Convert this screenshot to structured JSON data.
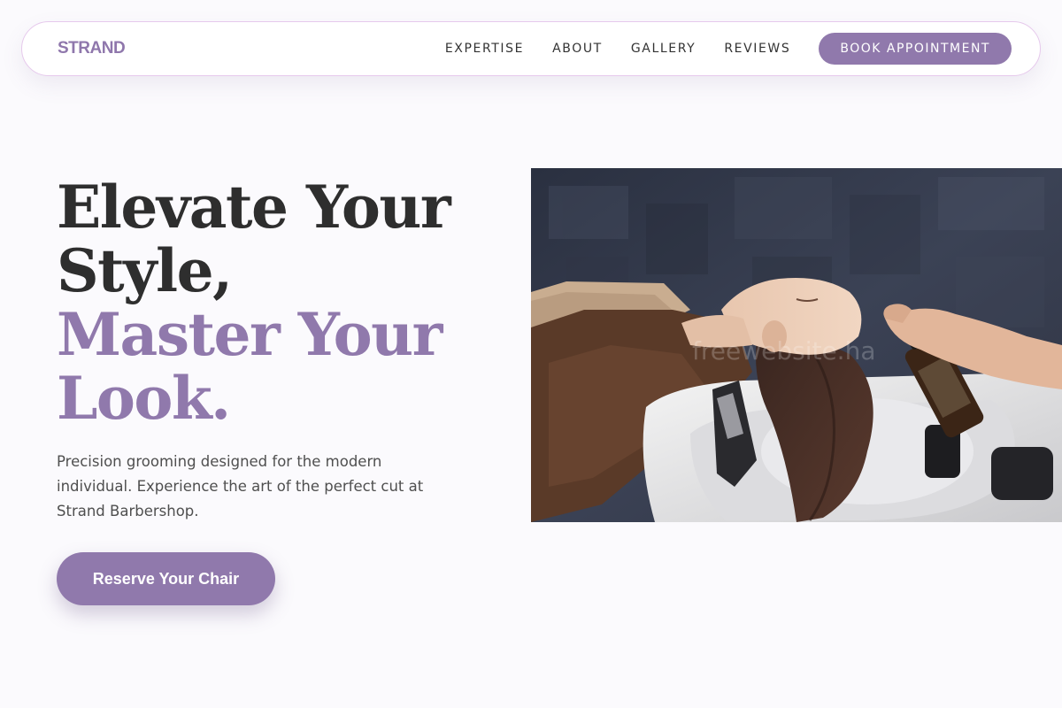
{
  "brand": {
    "name": "STRAND",
    "accent_color": "#9079ac",
    "text_color": "#2e2e2e"
  },
  "nav": {
    "links": [
      {
        "label": "EXPERTISE"
      },
      {
        "label": "ABOUT"
      },
      {
        "label": "GALLERY"
      },
      {
        "label": "REVIEWS"
      }
    ],
    "cta_label": "BOOK APPOINTMENT"
  },
  "hero": {
    "title_line_1": "Elevate Your",
    "title_line_2": "Style,",
    "title_line_3": "Master Your",
    "title_line_4": "Look.",
    "description": "Precision grooming designed for the modern individual. Experience the art of the perfect cut at Strand Barbershop.",
    "cta_label": "Reserve Your Chair",
    "image": {
      "subject": "woman-hair-wash-photo",
      "watermark": "freewebsite.ha"
    }
  }
}
